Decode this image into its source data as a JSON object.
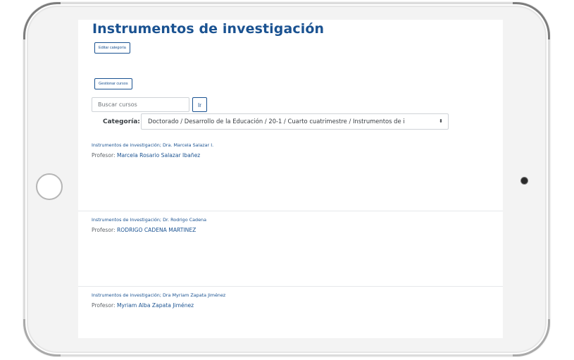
{
  "page": {
    "title": "Instrumentos de investigación",
    "edit_category_label": "Editar categoría",
    "manage_courses_label": "Gestionar cursos"
  },
  "search": {
    "placeholder": "Buscar cursos",
    "go_label": "Ir"
  },
  "category": {
    "label": "Categoría:",
    "selected": "Doctorado / Desarrollo de la Educación / 20-1 / Cuarto cuatrimestre / Instrumentos de i",
    "caret": "⬍"
  },
  "courses": [
    {
      "title": "Instrumentos de investigación; Dra. Marcela Salazar I.",
      "teacher_label": "Profesor: ",
      "teacher_name": "Marcela Rosario Salazar Ibañez"
    },
    {
      "title": "Instrumentos de Investigación; Dr. Rodrigo Cadena",
      "teacher_label": "Profesor: ",
      "teacher_name": "RODRIGO CADENA MARTINEZ"
    },
    {
      "title": "Instrumentos de investigación; Dra Myriam Zapata Jiménez",
      "teacher_label": "Profesor: ",
      "teacher_name": "Myriam Alba Zapata Jiménez"
    }
  ],
  "colors": {
    "brand_blue": "#1a5291",
    "text_dark": "#3a3f44",
    "text_muted": "#5f6468",
    "divider": "#e6e8ea",
    "device_frame": "#f3f3f3"
  },
  "icons": {
    "home_button": "home-button-icon",
    "camera": "camera-icon",
    "select_caret": "sort-caret-icon"
  }
}
